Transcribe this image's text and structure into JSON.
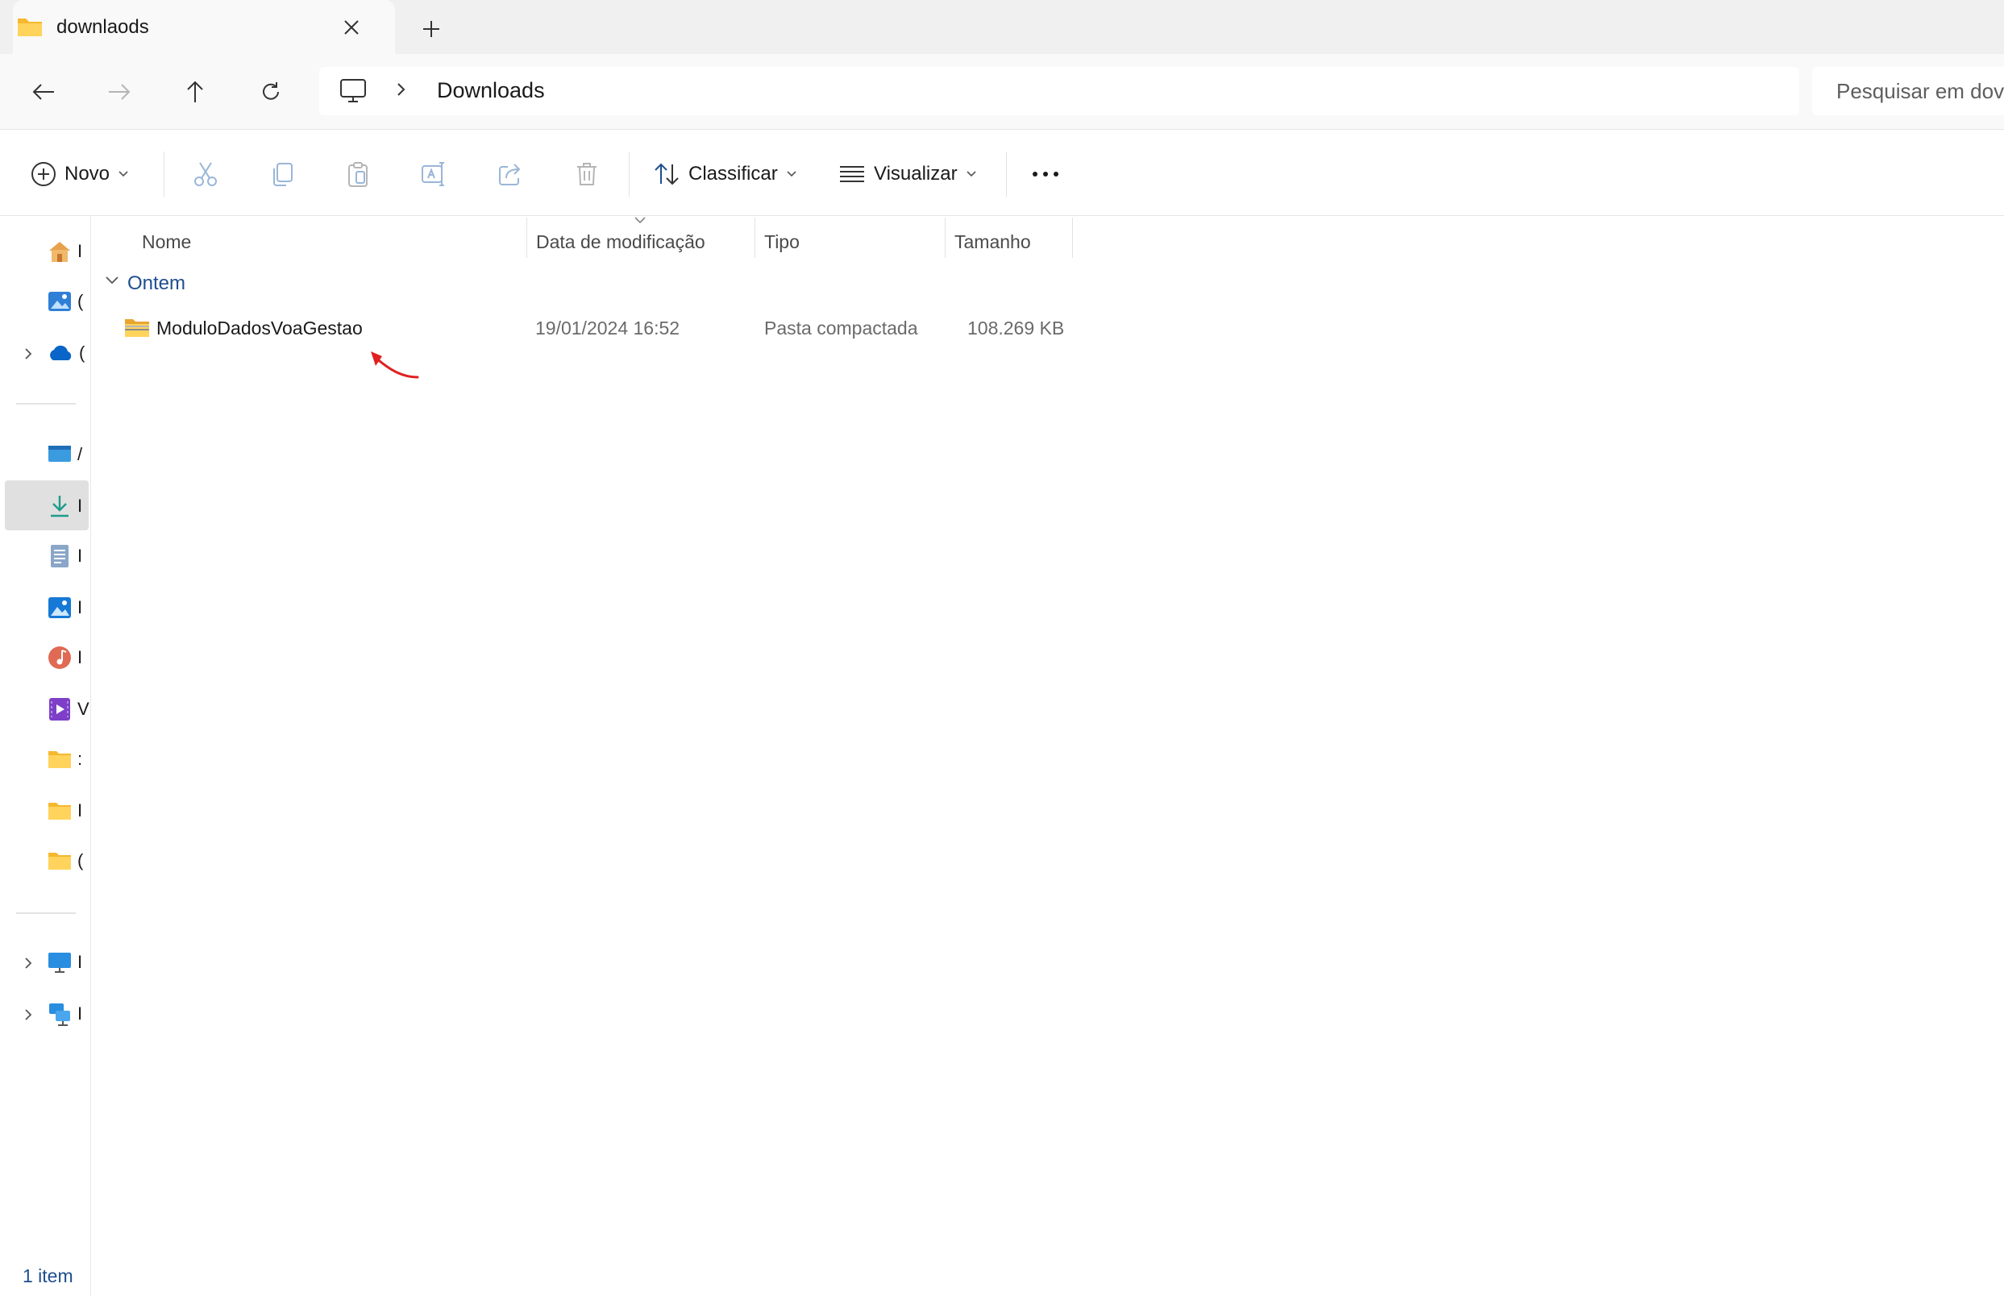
{
  "tab": {
    "title": "downlaods",
    "close_icon": "close-icon",
    "new_tab_icon": "plus-icon"
  },
  "navigation": {
    "back_icon": "arrow-left-icon",
    "forward_icon": "arrow-right-icon",
    "up_icon": "arrow-up-icon",
    "refresh_icon": "refresh-icon"
  },
  "address_bar": {
    "breadcrumb": [
      "Downloads"
    ],
    "root_icon": "computer-icon"
  },
  "search": {
    "placeholder": "Pesquisar em dov"
  },
  "command_bar": {
    "new_label": "Novo",
    "sort_label": "Classificar",
    "view_label": "Visualizar",
    "icons": [
      "cut-icon",
      "copy-icon",
      "paste-icon",
      "rename-icon",
      "share-icon",
      "delete-icon",
      "more-icon"
    ]
  },
  "columns": {
    "name": "Nome",
    "date_modified": "Data de modificação",
    "type": "Tipo",
    "size": "Tamanho"
  },
  "group": {
    "label": "Ontem"
  },
  "files": [
    {
      "name": "ModuloDadosVoaGestao",
      "date_modified": "19/01/2024 16:52",
      "type": "Pasta compactada",
      "size": "108.269 KB"
    }
  ],
  "sidebar": {
    "items": [
      {
        "icon": "home-icon",
        "label": "I"
      },
      {
        "icon": "gallery-icon",
        "label": "("
      },
      {
        "icon": "onedrive-icon",
        "label": "("
      },
      {
        "icon": "desktop-icon",
        "label": "/"
      },
      {
        "icon": "download-icon",
        "label": "I"
      },
      {
        "icon": "documents-icon",
        "label": "I"
      },
      {
        "icon": "pictures-icon",
        "label": "I"
      },
      {
        "icon": "music-icon",
        "label": "I"
      },
      {
        "icon": "videos-icon",
        "label": "V"
      },
      {
        "icon": "folder-icon",
        "label": ":"
      },
      {
        "icon": "folder-icon",
        "label": "I"
      },
      {
        "icon": "folder-icon",
        "label": "("
      },
      {
        "icon": "this-pc-icon",
        "label": "I"
      },
      {
        "icon": "network-icon",
        "label": "I"
      }
    ]
  },
  "status_bar": {
    "item_count": "1 item"
  },
  "colors": {
    "accent": "#1f4e8f",
    "annotation": "#e02020",
    "folder": "#f8c53a"
  }
}
